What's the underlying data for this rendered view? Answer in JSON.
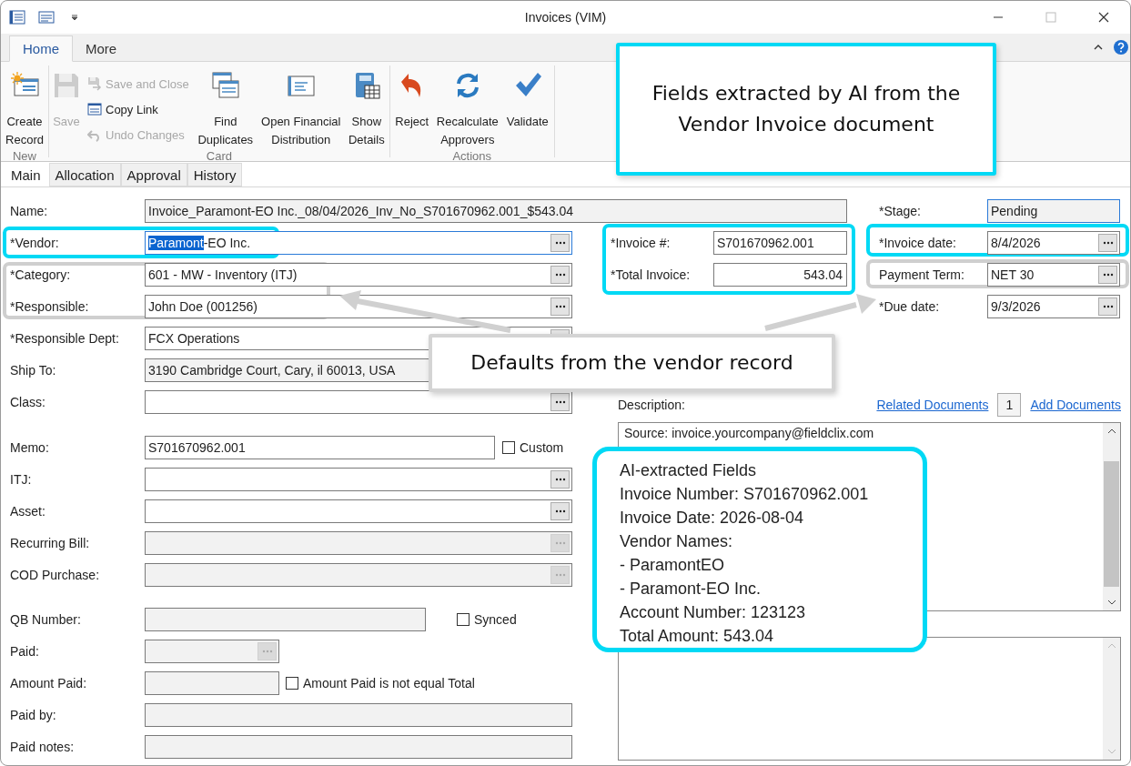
{
  "window": {
    "title": "Invoices (VIM)"
  },
  "ribbon_tabs": [
    {
      "label": "Home",
      "selected": true
    },
    {
      "label": "More",
      "selected": false
    }
  ],
  "ribbon_groups": [
    {
      "label": "New",
      "items": [
        {
          "kind": "large",
          "label": "Create Record",
          "disabled": false
        }
      ]
    },
    {
      "label": "Card",
      "items": [
        {
          "kind": "large",
          "label": "Save",
          "disabled": true
        },
        {
          "kind": "small",
          "label": "Save and Close",
          "disabled": true
        },
        {
          "kind": "small",
          "label": "Copy Link",
          "disabled": false
        },
        {
          "kind": "small",
          "label": "Undo Changes",
          "disabled": true
        },
        {
          "kind": "large",
          "label": "Find Duplicates",
          "disabled": false
        },
        {
          "kind": "large",
          "label": "Open Financial Distribution",
          "disabled": false
        },
        {
          "kind": "large",
          "label": "Show Details",
          "disabled": false
        }
      ]
    },
    {
      "label": "Actions",
      "items": [
        {
          "kind": "large",
          "label": "Reject",
          "disabled": false
        },
        {
          "kind": "large",
          "label": "Recalculate Approvers",
          "disabled": false
        },
        {
          "kind": "large",
          "label": "Validate",
          "disabled": false
        }
      ]
    }
  ],
  "form_tabs": [
    {
      "label": "Main",
      "selected": true
    },
    {
      "label": "Allocation",
      "selected": false
    },
    {
      "label": "Approval",
      "selected": false
    },
    {
      "label": "History",
      "selected": false
    }
  ],
  "name_field": {
    "label": "Name:",
    "value": "Invoice_Paramont-EO Inc._08/04/2026_Inv_No_S701670962.001_$543.04",
    "readonly": true
  },
  "stage_field": {
    "label": "*Stage:",
    "value": "Pending",
    "readonly": true,
    "focused": true
  },
  "left_sections": [
    [
      {
        "kind": "lookup",
        "label": "*Vendor:",
        "value_parts": [
          {
            "text": "Paramont",
            "selected": true
          },
          {
            "text": "-EO Inc.",
            "selected": false
          }
        ],
        "readonly": false,
        "focused": true
      },
      {
        "kind": "lookup",
        "label": "*Category:",
        "value": "601 - MW - Inventory (ITJ)",
        "readonly": false,
        "focused": false
      },
      {
        "kind": "lookup",
        "label": "*Responsible:",
        "value": "John Doe (001256)",
        "readonly": false,
        "focused": false
      },
      {
        "kind": "lookup",
        "label": "*Responsible Dept:",
        "value": "FCX Operations",
        "readonly": false,
        "focused": false
      },
      {
        "kind": "text",
        "label": "Ship To:",
        "value": "3190 Cambridge Court, Cary, il 60013, USA",
        "readonly": true,
        "focused": false
      },
      {
        "kind": "lookup",
        "label": "Class:",
        "readonly": false,
        "focused": false
      }
    ],
    [
      {
        "kind": "text-check",
        "label": "Memo:",
        "value": "S701670962.001",
        "readonly": false,
        "focused": false,
        "checkbox": {
          "label": "Custom",
          "checked": false
        }
      },
      {
        "kind": "lookup",
        "label": "ITJ:",
        "readonly": false,
        "focused": false
      },
      {
        "kind": "lookup",
        "label": "Asset:",
        "readonly": false,
        "focused": false
      },
      {
        "kind": "lookup",
        "label": "Recurring Bill:",
        "readonly": true,
        "focused": false
      },
      {
        "kind": "lookup",
        "label": "COD Purchase:",
        "readonly": true,
        "focused": false
      }
    ],
    [
      {
        "kind": "text-check",
        "label": "QB Number:",
        "readonly": true,
        "focused": false,
        "checkbox": {
          "label": "Synced",
          "checked": false
        }
      },
      {
        "kind": "short-lookup",
        "label": "Paid:",
        "readonly": true,
        "focused": false
      },
      {
        "kind": "short-check",
        "label": "Amount Paid:",
        "readonly": true,
        "focused": false,
        "checkbox": {
          "label": "Amount Paid is not equal Total",
          "checked": false
        }
      },
      {
        "kind": "text",
        "label": "Paid by:",
        "readonly": true,
        "focused": false
      },
      {
        "kind": "text",
        "label": "Paid notes:",
        "readonly": true,
        "focused": false
      }
    ]
  ],
  "invoice_fields": [
    {
      "kind": "text",
      "label": "*Invoice #:",
      "value": "S701670962.001"
    },
    {
      "kind": "amount",
      "label": "*Total Invoice:",
      "value": "543.04"
    }
  ],
  "date_fields": [
    {
      "label": "*Invoice date:",
      "value": "8/4/2026"
    },
    {
      "label": "Payment Term:",
      "value": "NET 30"
    },
    {
      "label": "*Due date:",
      "value": "9/3/2026"
    }
  ],
  "description": {
    "label": "Description:",
    "related_link": "Related Documents",
    "document_count": "1",
    "add_link": "Add Documents",
    "text": "Source: invoice.yourcompany@fieldclix.com"
  },
  "callouts": [
    {
      "kind": "ai",
      "text": "Fields extracted by AI from the Vendor Invoice document"
    },
    {
      "kind": "defaults",
      "text": "Defaults from the vendor record"
    }
  ],
  "extracted_fields": {
    "lines": [
      "AI-extracted Fields",
      "Invoice Number: S701670962.001",
      "Invoice Date: 2026-08-04",
      "Vendor Names:",
      "- ParamontEO",
      "- Paramont-EO Inc.",
      "Account Number: 123123",
      "Total Amount: 543.04"
    ]
  }
}
